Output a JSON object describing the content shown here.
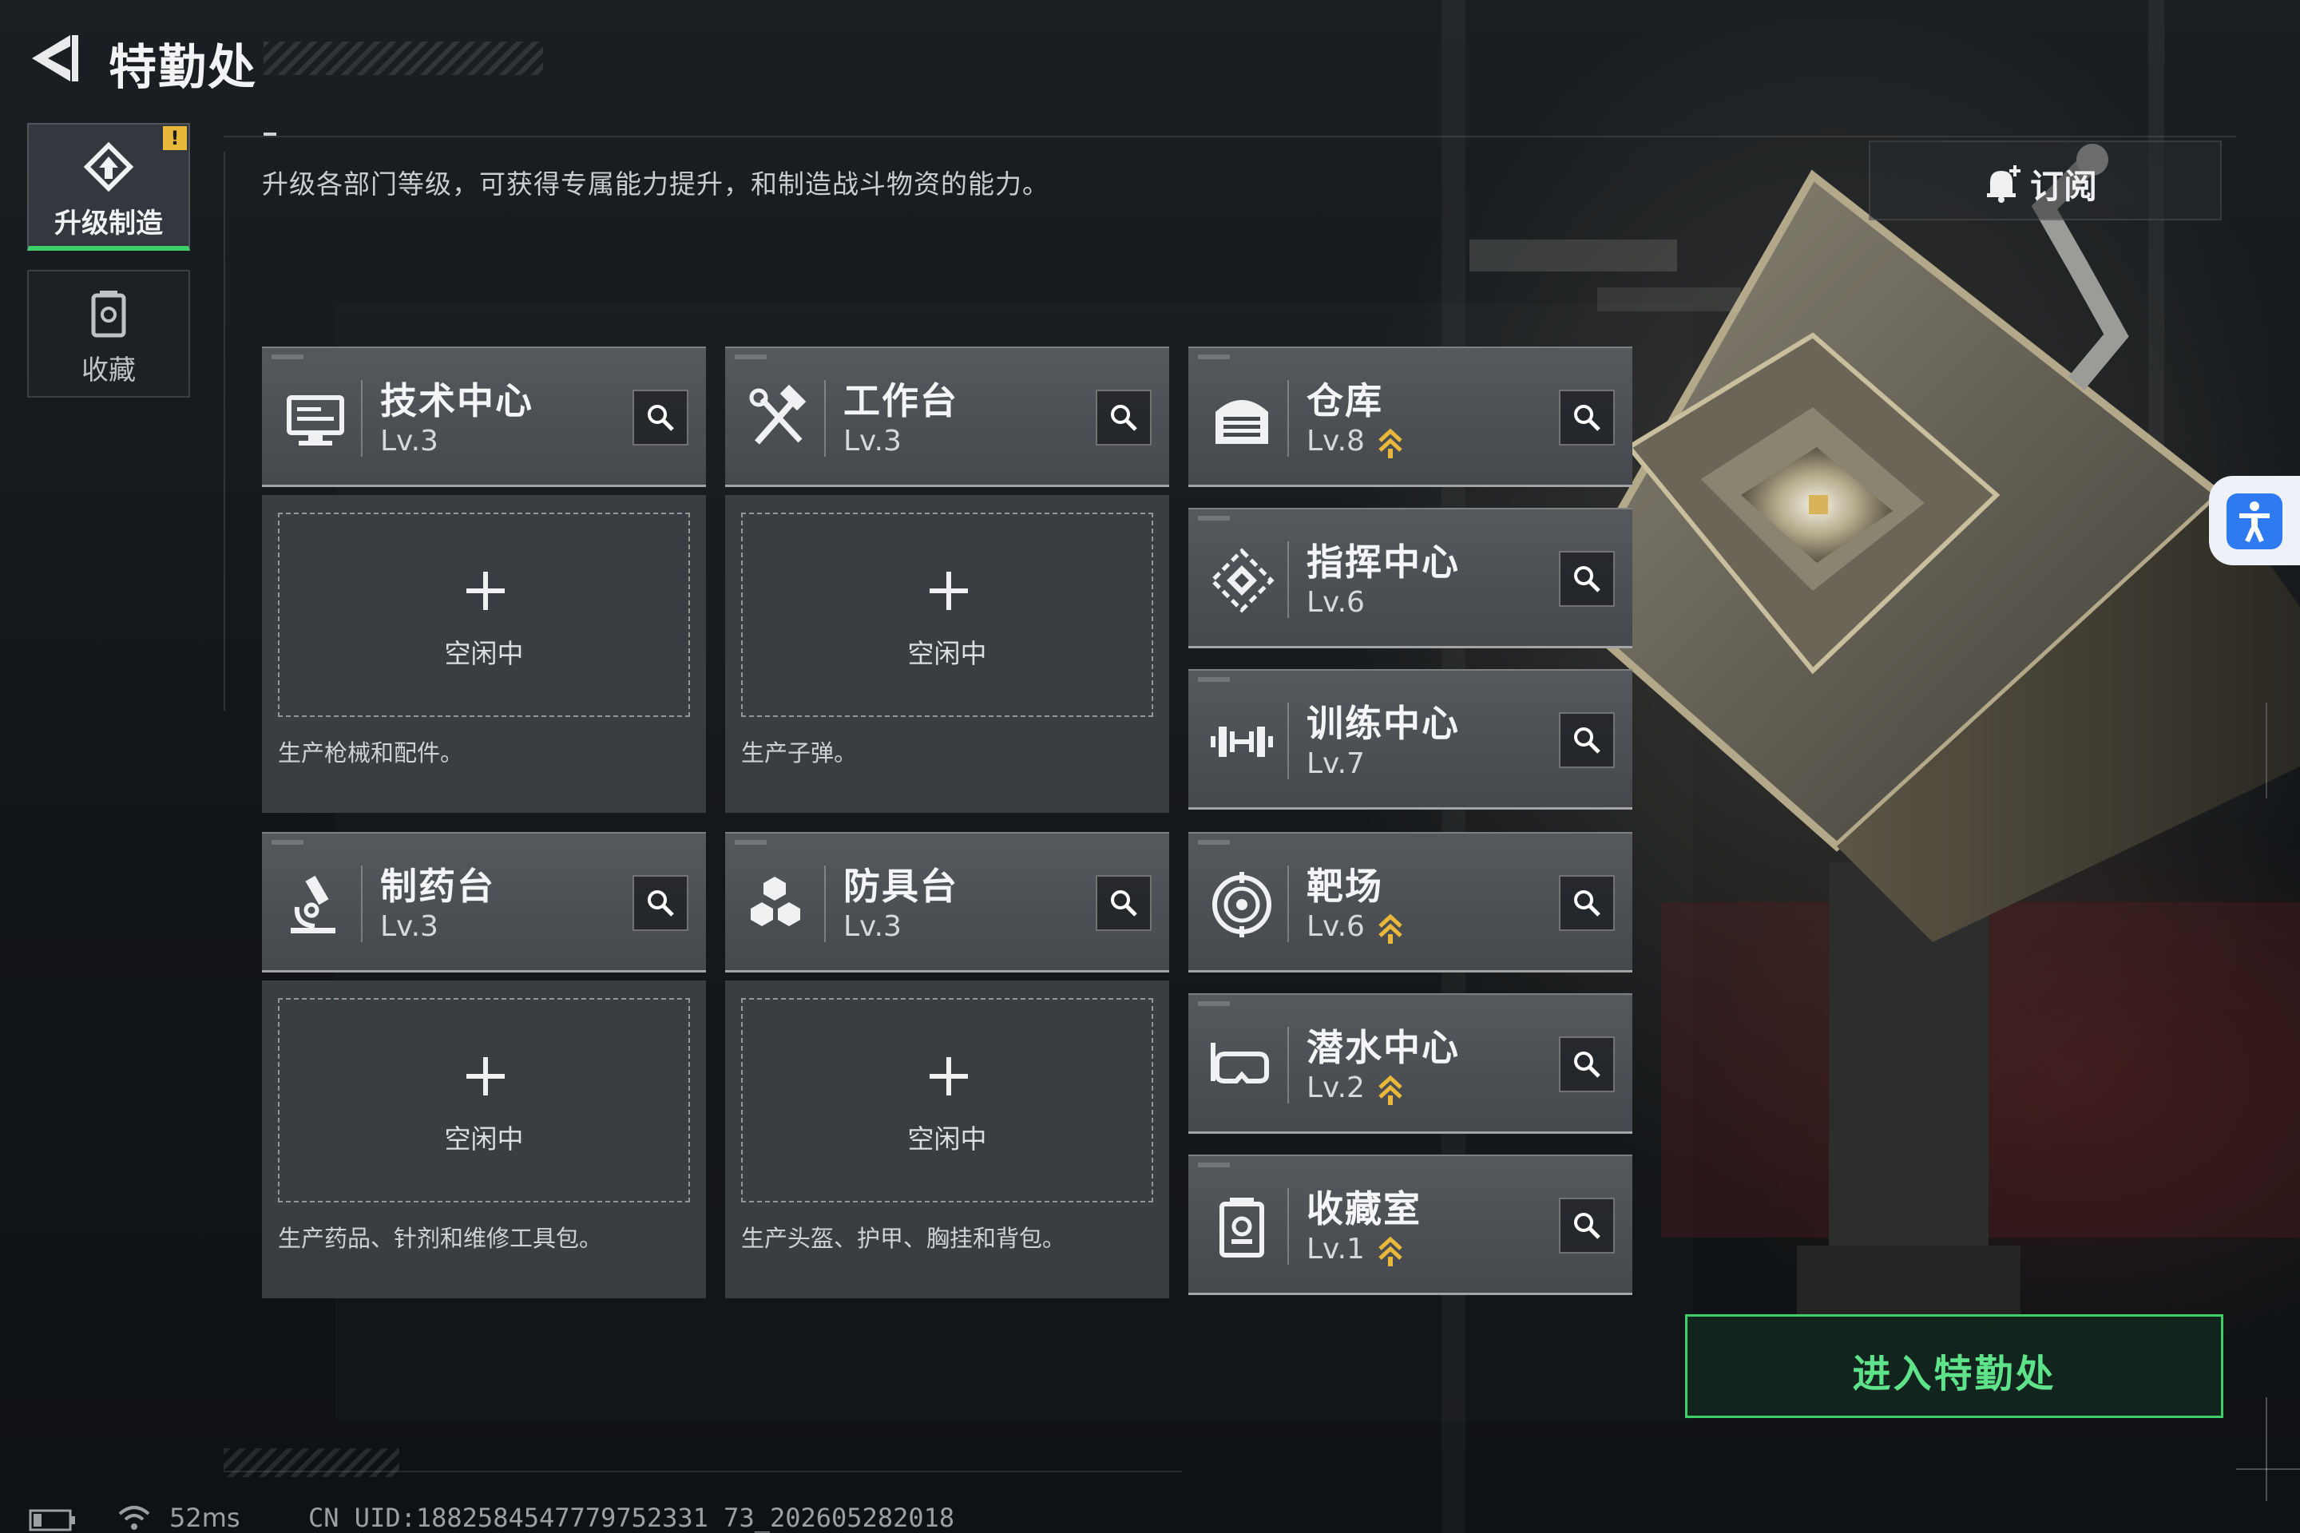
{
  "header": {
    "title": "特勤处"
  },
  "description": "升级各部门等级，可获得专属能力提升，和制造战斗物资的能力。",
  "sidebar": {
    "tabs": [
      {
        "label": "升级制造",
        "icon": "upgrade-craft-icon",
        "active": true,
        "alert": "!"
      },
      {
        "label": "收藏",
        "icon": "collection-icon",
        "active": false
      }
    ]
  },
  "subscribe": {
    "label": "订阅",
    "icon": "bell-plus-icon"
  },
  "facilities": [
    {
      "name": "技术中心",
      "level": "Lv.3",
      "icon": "monitor-icon",
      "upgradable": false
    },
    {
      "name": "工作台",
      "level": "Lv.3",
      "icon": "hammer-wrench-icon",
      "upgradable": false
    },
    {
      "name": "仓库",
      "level": "Lv.8",
      "icon": "warehouse-icon",
      "upgradable": true
    },
    {
      "name": "指挥中心",
      "level": "Lv.6",
      "icon": "command-diamond-icon",
      "upgradable": false
    },
    {
      "name": "训练中心",
      "level": "Lv.7",
      "icon": "dumbbell-icon",
      "upgradable": false
    },
    {
      "name": "制药台",
      "level": "Lv.3",
      "icon": "microscope-icon",
      "upgradable": false
    },
    {
      "name": "防具台",
      "level": "Lv.3",
      "icon": "armor-blocks-icon",
      "upgradable": false
    },
    {
      "name": "靶场",
      "level": "Lv.6",
      "icon": "target-icon",
      "upgradable": true
    },
    {
      "name": "潜水中心",
      "level": "Lv.2",
      "icon": "diving-mask-icon",
      "upgradable": true
    },
    {
      "name": "收藏室",
      "level": "Lv.1",
      "icon": "collection-room-icon",
      "upgradable": true
    }
  ],
  "slots": [
    {
      "status": "空闲中",
      "desc": "生产枪械和配件。"
    },
    {
      "status": "空闲中",
      "desc": "生产子弹。"
    },
    {
      "status": "空闲中",
      "desc": "生产药品、针剂和维修工具包。"
    },
    {
      "status": "空闲中",
      "desc": "生产头盔、护甲、胸挂和背包。"
    }
  ],
  "enter_button": {
    "label": "进入特勤处"
  },
  "status_bar": {
    "ping": "52ms",
    "uid": "CN UID:1882584547779752331 73_202605282018"
  },
  "colors": {
    "accent_green": "#3fcf6a",
    "upgrade_gold": "#e7b83a",
    "accessibility_blue": "#2e7af0"
  }
}
